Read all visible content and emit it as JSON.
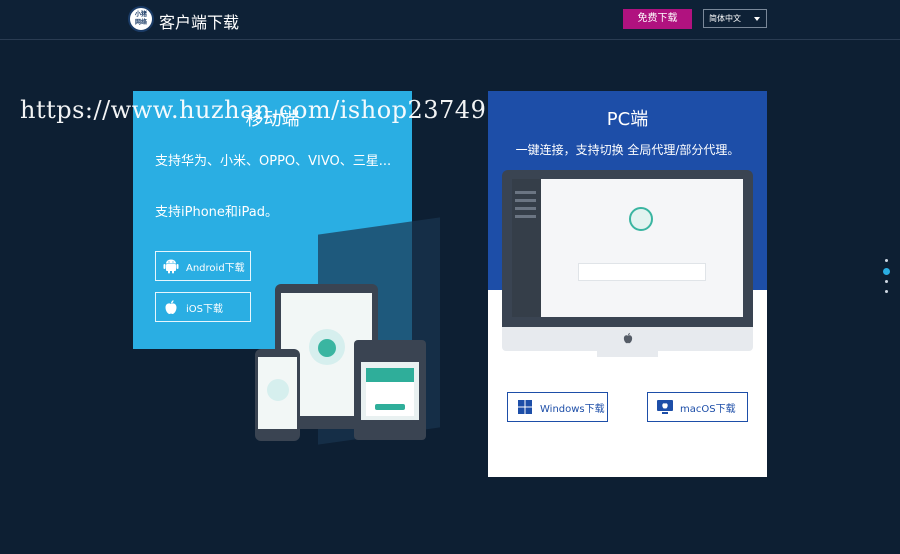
{
  "header": {
    "logo_text": "小猪网络",
    "title": "客户端下载",
    "free_button": "免费下载",
    "language": "简体中文"
  },
  "watermark": "https://www.huzhan.com/ishop23749",
  "mobile": {
    "title": "移动端",
    "desc1": "支持华为、小米、OPPO、VIVO、三星...",
    "desc2": "支持iPhone和iPad。",
    "android_button": "Android下载",
    "ios_button": "iOS下载"
  },
  "pc": {
    "title": "PC端",
    "desc": "一键连接，支持切换 全局代理/部分代理。",
    "windows_button": "Windows下载",
    "macos_button": "macOS下载"
  },
  "colors": {
    "background": "#0d1f33",
    "mobile_card": "#2aaee3",
    "pc_card_top": "#1d4ea8",
    "free_button": "#b0127f"
  },
  "nav_dots": {
    "count": 4,
    "active_index": 0
  }
}
